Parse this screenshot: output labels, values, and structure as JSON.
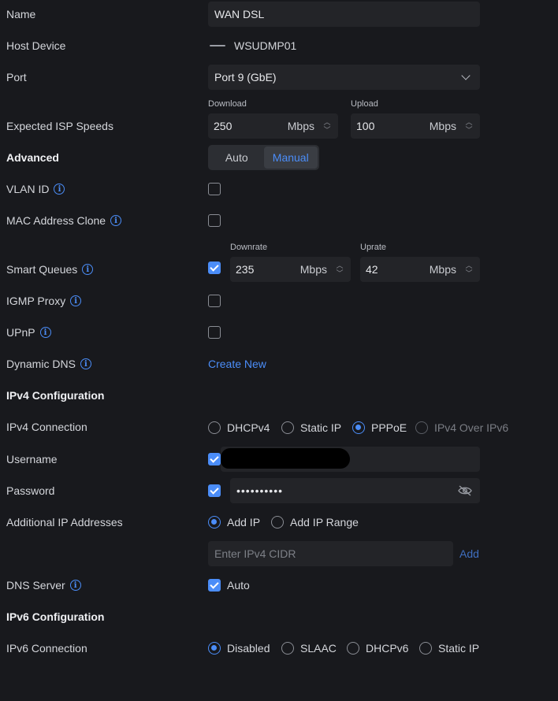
{
  "name": {
    "label": "Name",
    "value": "WAN DSL"
  },
  "host_device": {
    "label": "Host Device",
    "value": "WSUDMP01",
    "icon": "device-dash-icon"
  },
  "port": {
    "label": "Port",
    "value": "Port 9 (GbE)"
  },
  "isp_speeds": {
    "label": "Expected ISP Speeds",
    "download_label": "Download",
    "download_value": "250",
    "download_unit": "Mbps",
    "upload_label": "Upload",
    "upload_value": "100",
    "upload_unit": "Mbps"
  },
  "advanced": {
    "label": "Advanced",
    "options": [
      "Auto",
      "Manual"
    ],
    "selected": "Manual"
  },
  "vlan_id": {
    "label": "VLAN ID",
    "checked": false
  },
  "mac_clone": {
    "label": "MAC Address Clone",
    "checked": false
  },
  "smart_queues": {
    "label": "Smart Queues",
    "checked": true,
    "downrate_label": "Downrate",
    "downrate_value": "235",
    "downrate_unit": "Mbps",
    "uprate_label": "Uprate",
    "uprate_value": "42",
    "uprate_unit": "Mbps"
  },
  "igmp_proxy": {
    "label": "IGMP Proxy",
    "checked": false
  },
  "upnp": {
    "label": "UPnP",
    "checked": false
  },
  "dynamic_dns": {
    "label": "Dynamic DNS",
    "link": "Create New"
  },
  "ipv4_section": "IPv4 Configuration",
  "ipv4_connection": {
    "label": "IPv4 Connection",
    "options": [
      "DHCPv4",
      "Static IP",
      "PPPoE",
      "IPv4 Over IPv6"
    ],
    "selected": "PPPoE"
  },
  "username": {
    "label": "Username",
    "checked": true
  },
  "password": {
    "label": "Password",
    "checked": true,
    "value": "••••••••••"
  },
  "additional_ip": {
    "label": "Additional IP Addresses",
    "options": [
      "Add IP",
      "Add IP Range"
    ],
    "selected": "Add IP",
    "placeholder": "Enter IPv4 CIDR",
    "add_label": "Add"
  },
  "dns_server": {
    "label": "DNS Server",
    "checked": true,
    "option_label": "Auto"
  },
  "ipv6_section": "IPv6 Configuration",
  "ipv6_connection": {
    "label": "IPv6 Connection",
    "options": [
      "Disabled",
      "SLAAC",
      "DHCPv6",
      "Static IP"
    ],
    "selected": "Disabled"
  },
  "colors": {
    "accent": "#4b8df8",
    "background": "#18191d",
    "field": "#232428"
  }
}
